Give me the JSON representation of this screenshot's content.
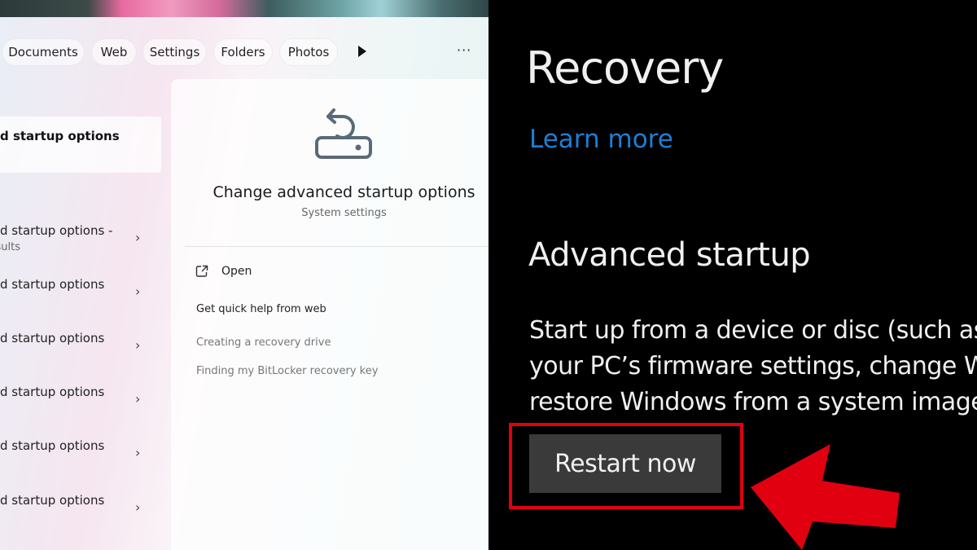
{
  "search": {
    "filters": [
      "Documents",
      "Web",
      "Settings",
      "Folders",
      "Photos"
    ],
    "more_label": "···",
    "best_match": "Change advanced startup options",
    "results": [
      {
        "title": "Change advanced startup options -",
        "subtitle": "See web results"
      },
      {
        "title": "Change advanced startup options"
      },
      {
        "title": "Change advanced startup options"
      },
      {
        "title": "Change advanced startup options"
      },
      {
        "title": "Change advanced startup options"
      },
      {
        "title": "Change advanced startup options"
      }
    ],
    "best_match_visible": "d startup options",
    "result_visible": [
      "d startup options -",
      "d startup options",
      "d startup options",
      "d startup options",
      "d startup options",
      "d startup options"
    ],
    "result_sub_visible": "sults"
  },
  "detail": {
    "title": "Change advanced startup options",
    "subtitle": "System settings",
    "open_label": "Open",
    "help_heading": "Get quick help from web",
    "links": [
      "Creating a recovery drive",
      "Finding my BitLocker recovery key"
    ]
  },
  "recovery": {
    "title": "Recovery",
    "learn_more": "Learn more",
    "section": "Advanced startup",
    "body_lines": [
      "Start up from a device or disc (such as",
      "your PC’s firmware settings, change W",
      "restore Windows from a system image"
    ],
    "button": "Restart now",
    "highlight_color": "#e0000f",
    "link_color": "#1b7fd6"
  }
}
